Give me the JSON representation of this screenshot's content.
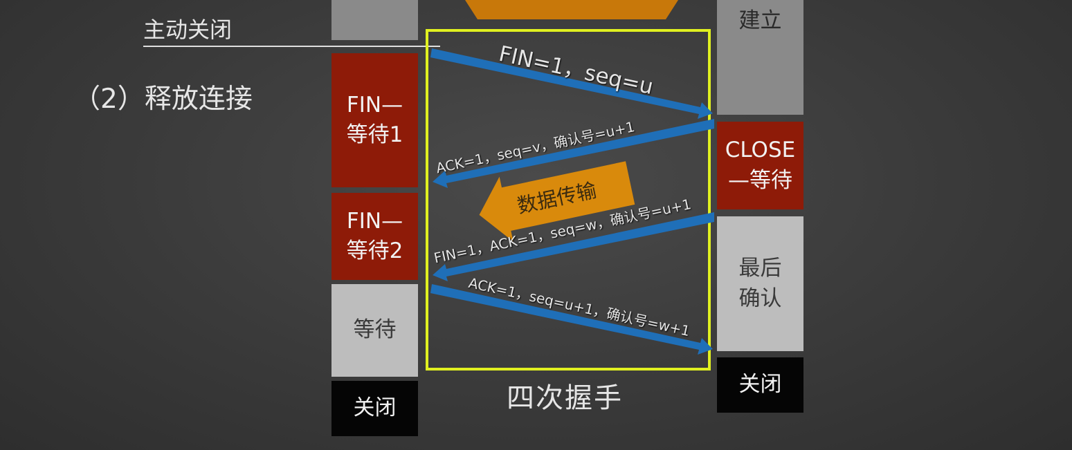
{
  "left_label": "主动关闭",
  "section_title": "（2）释放连接",
  "caption": "四次握手",
  "left_column": [
    {
      "text": "",
      "color": "gray"
    },
    {
      "text": "FIN—\n等待1",
      "color": "red"
    },
    {
      "text": "FIN—\n等待2",
      "color": "red"
    },
    {
      "text": "等待",
      "color": "lightgray"
    },
    {
      "text": "关闭",
      "color": "black"
    }
  ],
  "right_column": [
    {
      "text": "连接已\n建立",
      "color": "gray"
    },
    {
      "text": "CLOSE\n—等待",
      "color": "red"
    },
    {
      "text": "最后\n确认",
      "color": "lightgray"
    },
    {
      "text": "关闭",
      "color": "black"
    }
  ],
  "messages": [
    {
      "text": "FIN=1，seq=u",
      "direction": "client-to-server"
    },
    {
      "text": "ACK=1，seq=v，确认号=u+1",
      "direction": "server-to-client"
    },
    {
      "text": "FIN=1，ACK=1，seq=w，确认号=u+1",
      "direction": "server-to-client"
    },
    {
      "text": "ACK=1，seq=u+1，确认号=w+1",
      "direction": "client-to-server"
    }
  ],
  "data_transfer_label": "数据传输",
  "colors": {
    "red_state": "#8e1b08",
    "arrow_blue": "#1f6fb8",
    "highlight": "#e0f020",
    "orange": "#d98a0c"
  }
}
